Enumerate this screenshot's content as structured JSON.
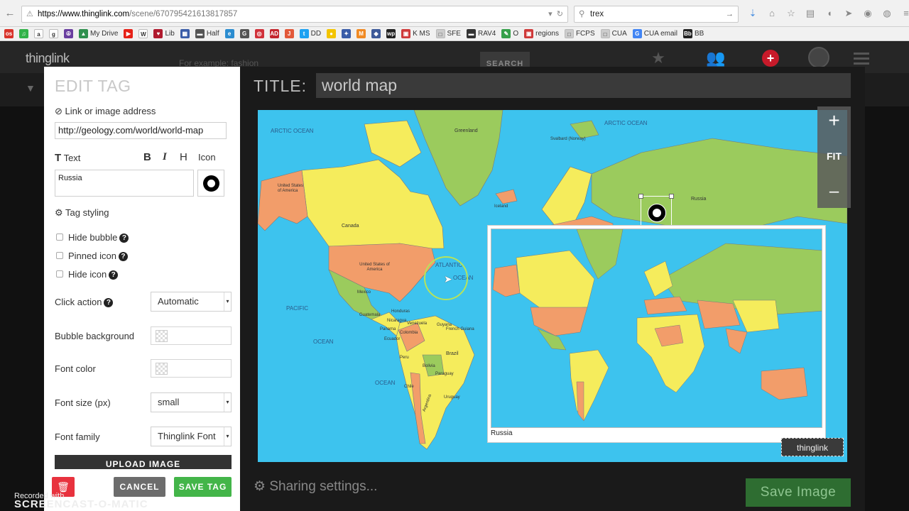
{
  "browser": {
    "url_host": "https://www.thinglink.com",
    "url_path": "/scene/670795421613817857",
    "search_value": "trex"
  },
  "bookmarks": [
    {
      "label": "",
      "icon": "os-icon",
      "color": "#d9342b",
      "glyph": "os"
    },
    {
      "label": "",
      "icon": "spotify-icon",
      "color": "#33b24a",
      "glyph": "♫"
    },
    {
      "label": "",
      "icon": "amazon-icon",
      "color": "#ffffff",
      "glyph": "a"
    },
    {
      "label": "",
      "icon": "g-icon",
      "color": "#ffffff",
      "glyph": "g"
    },
    {
      "label": "",
      "icon": "peace-icon",
      "color": "#6a3fa0",
      "glyph": "☮"
    },
    {
      "label": "My Drive",
      "icon": "drive-icon",
      "color": "#2f8f4e",
      "glyph": "▲"
    },
    {
      "label": "",
      "icon": "youtube-icon",
      "color": "#e62117",
      "glyph": "▶"
    },
    {
      "label": "",
      "icon": "wikipedia-icon",
      "color": "#ffffff",
      "glyph": "W"
    },
    {
      "label": "Lib",
      "icon": "heart-icon",
      "color": "#b01a2e",
      "glyph": "♥"
    },
    {
      "label": "",
      "icon": "cal-icon",
      "color": "#3a5da8",
      "glyph": "▦"
    },
    {
      "label": "Half",
      "icon": "half-icon",
      "color": "#555555",
      "glyph": "▬"
    },
    {
      "label": "",
      "icon": "edmodo-icon",
      "color": "#2c8dd0",
      "glyph": "e"
    },
    {
      "label": "",
      "icon": "google-g-icon",
      "color": "#555555",
      "glyph": "G"
    },
    {
      "label": "",
      "icon": "target-icon",
      "color": "#d1313a",
      "glyph": "◎"
    },
    {
      "label": "",
      "icon": "ad-icon",
      "color": "#c3262d",
      "glyph": "AD"
    },
    {
      "label": "",
      "icon": "j-icon",
      "color": "#e2593a",
      "glyph": "J"
    },
    {
      "label": "DD",
      "icon": "twitter-icon",
      "color": "#1da1f2",
      "glyph": "t"
    },
    {
      "label": "",
      "icon": "yellow-dot-icon",
      "color": "#f3c400",
      "glyph": "●"
    },
    {
      "label": "",
      "icon": "puzzle-icon",
      "color": "#3a5da8",
      "glyph": "✦"
    },
    {
      "label": "",
      "icon": "arches-icon",
      "color": "#f08a24",
      "glyph": "M"
    },
    {
      "label": "",
      "icon": "car-icon",
      "color": "#3d5a99",
      "glyph": "◆"
    },
    {
      "label": "",
      "icon": "wp-icon",
      "color": "#222222",
      "glyph": "wp"
    },
    {
      "label": "K MS",
      "icon": "kms-icon",
      "color": "#cf3a3a",
      "glyph": "▣"
    },
    {
      "label": "SFE",
      "icon": "page-icon",
      "color": "#cccccc",
      "glyph": "□"
    },
    {
      "label": "RAV4",
      "icon": "rav4-icon",
      "color": "#333333",
      "glyph": "▬"
    },
    {
      "label": "O",
      "icon": "leaf-icon",
      "color": "#35a04a",
      "glyph": "✎"
    },
    {
      "label": "regions",
      "icon": "regions-icon",
      "color": "#cf3a3a",
      "glyph": "▣"
    },
    {
      "label": "FCPS",
      "icon": "page-icon",
      "color": "#cccccc",
      "glyph": "□"
    },
    {
      "label": "CUA",
      "icon": "page-icon",
      "color": "#cccccc",
      "glyph": "□"
    },
    {
      "label": "CUA email",
      "icon": "google-g-icon",
      "color": "#4285f4",
      "glyph": "G"
    },
    {
      "label": "BB",
      "icon": "bb-icon",
      "color": "#222222",
      "glyph": "Bb"
    }
  ],
  "site": {
    "logo": "thinglink",
    "search_placeholder": "For example: fashion",
    "search_button": "SEARCH"
  },
  "edit_tag": {
    "title": "EDIT TAG",
    "link_label": "Link or image address",
    "link_value": "http://geology.com/world/world-map",
    "text_label": "Text",
    "bold": "B",
    "italic": "I",
    "heading": "H",
    "icon_label": "Icon",
    "text_value": "Russia",
    "tag_styling": "Tag styling",
    "hide_bubble": "Hide bubble",
    "pinned_icon": "Pinned icon",
    "hide_icon": "Hide icon",
    "click_action_label": "Click action",
    "click_action_value": "Automatic",
    "bubble_background_label": "Bubble background",
    "font_color_label": "Font color",
    "font_size_label": "Font size (px)",
    "font_size_value": "small",
    "font_family_label": "Font family",
    "font_family_value": "Thinglink Font",
    "upload_image": "UPLOAD IMAGE",
    "cancel": "CANCEL",
    "save_tag": "SAVE TAG"
  },
  "editor": {
    "title_label": "TITLE:",
    "title_value": "world map",
    "zoom_in": "+",
    "fit": "FIT",
    "zoom_out": "–",
    "popup_caption": "Russia",
    "badge": "thinglink",
    "sharing": "Sharing settings...",
    "save_image": "Save Image"
  },
  "map_labels": {
    "arctic_ocean": "ARCTIC OCEAN",
    "arctic_ocean_2": "ARCTIC OCEAN",
    "greenland": "Greenland",
    "svalbard": "Svalbard (Norway)",
    "iceland": "Iceland",
    "russia": "Russia",
    "alaska": "United States of America",
    "canada": "Canada",
    "usa": "United States of America",
    "atlantic": "ATLANTIC",
    "ocean_atl": "OCEAN",
    "pacific": "PACIFIC",
    "ocean_pac": "OCEAN",
    "mexico": "Mexico",
    "guatemala": "Guatemala",
    "honduras": "Honduras",
    "nicaragua": "Nicaragua",
    "panama": "Panama",
    "venezuela": "Venezuela",
    "guyana": "Guyana",
    "french_guiana": "French Guiana",
    "colombia": "Colombia",
    "ecuador": "Ecuador",
    "peru": "Peru",
    "brazil": "Brazil",
    "bolivia": "Bolivia",
    "paraguay": "Paraguay",
    "chile": "Chile",
    "argentina": "Argentina",
    "uruguay": "Uruguay",
    "pacific_lower": "OCEAN"
  },
  "watermark": {
    "line1": "Recorded with",
    "line2": "SCREENCAST-O-MATIC"
  },
  "colors": {
    "ocean": "#3dc3ee",
    "land_green": "#9bcb5d",
    "land_yellow": "#f5ec5c",
    "land_orange": "#f29d6a",
    "save_green": "#43b549",
    "delete_red": "#e8323e"
  }
}
